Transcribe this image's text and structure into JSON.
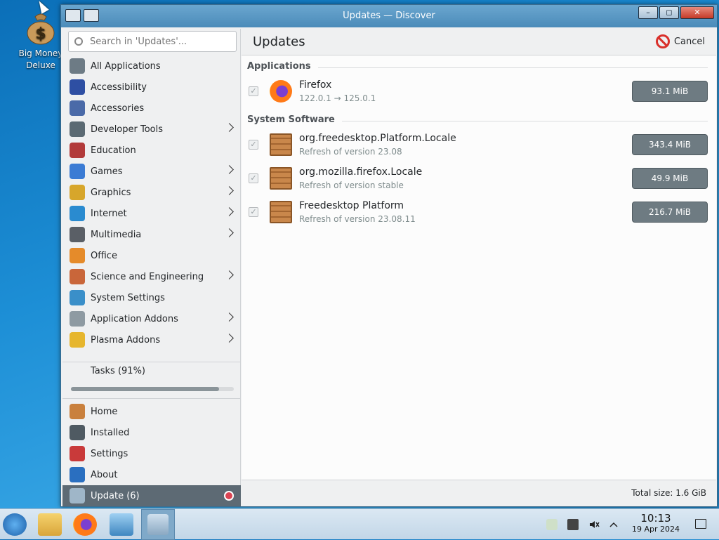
{
  "desktop": {
    "icon_label_1": "Big Money",
    "icon_label_2": "Deluxe"
  },
  "window": {
    "title": "Updates — Discover",
    "buttons": {
      "minimize": "–",
      "maximize": "◻",
      "close": "✕"
    }
  },
  "search": {
    "placeholder": "Search in 'Updates'..."
  },
  "sidebar": {
    "categories": [
      {
        "label": "All Applications",
        "icon": "grid-icon",
        "has_submenu": false,
        "color": "#6d7b85"
      },
      {
        "label": "Accessibility",
        "icon": "accessibility-icon",
        "has_submenu": false,
        "color": "#2e4fa3"
      },
      {
        "label": "Accessories",
        "icon": "accessories-icon",
        "has_submenu": false,
        "color": "#4a6aa8"
      },
      {
        "label": "Developer Tools",
        "icon": "developer-tools-icon",
        "has_submenu": true,
        "color": "#5b6a73"
      },
      {
        "label": "Education",
        "icon": "education-icon",
        "has_submenu": false,
        "color": "#b23a3a"
      },
      {
        "label": "Games",
        "icon": "games-icon",
        "has_submenu": true,
        "color": "#3b7bd4"
      },
      {
        "label": "Graphics",
        "icon": "graphics-icon",
        "has_submenu": true,
        "color": "#d7a62b"
      },
      {
        "label": "Internet",
        "icon": "internet-icon",
        "has_submenu": true,
        "color": "#2a8bd0"
      },
      {
        "label": "Multimedia",
        "icon": "multimedia-icon",
        "has_submenu": true,
        "color": "#5a5f66"
      },
      {
        "label": "Office",
        "icon": "office-icon",
        "has_submenu": false,
        "color": "#e58b2a"
      },
      {
        "label": "Science and Engineering",
        "icon": "science-icon",
        "has_submenu": true,
        "color": "#c9663a"
      },
      {
        "label": "System Settings",
        "icon": "system-settings-icon",
        "has_submenu": false,
        "color": "#3a8fc9"
      },
      {
        "label": "Application Addons",
        "icon": "application-addons-icon",
        "has_submenu": true,
        "color": "#8e9aa2"
      },
      {
        "label": "Plasma Addons",
        "icon": "plasma-addons-icon",
        "has_submenu": true,
        "color": "#e6b62e"
      }
    ],
    "tasks_label": "Tasks (91%)",
    "tasks_progress": 0.91,
    "nav": [
      {
        "label": "Home",
        "icon": "home-icon",
        "color": "#c9803d"
      },
      {
        "label": "Installed",
        "icon": "installed-icon",
        "color": "#4f5a62"
      },
      {
        "label": "Settings",
        "icon": "settings-icon",
        "color": "#c93a3a"
      },
      {
        "label": "About",
        "icon": "about-icon",
        "color": "#2a6fc0"
      },
      {
        "label": "Update (6)",
        "icon": "update-icon",
        "color": "#9fb6c8"
      }
    ]
  },
  "main": {
    "title": "Updates",
    "cancel_label": "Cancel",
    "sections": [
      {
        "label": "Applications",
        "items": [
          {
            "name": "Firefox",
            "desc": "122.0.1 → 125.0.1",
            "size": "93.1 MiB",
            "icon": "firefox-icon",
            "checked": true
          }
        ]
      },
      {
        "label": "System Software",
        "items": [
          {
            "name": "org.freedesktop.Platform.Locale",
            "desc": "Refresh of version 23.08",
            "size": "343.4 MiB",
            "icon": "package-icon",
            "checked": true
          },
          {
            "name": "org.mozilla.firefox.Locale",
            "desc": "Refresh of version stable",
            "size": "49.9 MiB",
            "icon": "package-icon",
            "checked": true
          },
          {
            "name": "Freedesktop Platform",
            "desc": "Refresh of version 23.08.11",
            "size": "216.7 MiB",
            "icon": "package-icon",
            "checked": true
          }
        ]
      }
    ],
    "total_size": "Total size: 1.6 GiB"
  },
  "taskbar": {
    "time": "10:13",
    "date": "19 Apr 2024"
  }
}
